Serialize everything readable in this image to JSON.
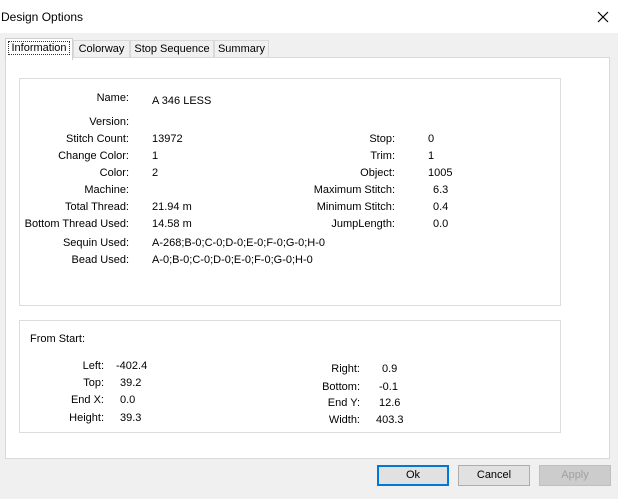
{
  "window": {
    "title": "Design Options",
    "close_icon": "close-icon"
  },
  "tabs": [
    "Information",
    "Colorway",
    "Stop Sequence",
    "Summary"
  ],
  "info": {
    "name_label": "Name:",
    "name_value": "A 346 LESS",
    "version_label": "Version:",
    "version_value": "",
    "stitch_count_label": "Stitch Count:",
    "stitch_count_value": "13972",
    "change_color_label": "Change Color:",
    "change_color_value": "1",
    "color_label": "Color:",
    "color_value": "2",
    "machine_label": "Machine:",
    "machine_value": "",
    "total_thread_label": "Total Thread:",
    "total_thread_value": "21.94 m",
    "bottom_thread_label": "Bottom Thread Used:",
    "bottom_thread_value": "14.58 m",
    "sequin_label": "Sequin Used:",
    "sequin_value": "A-268;B-0;C-0;D-0;E-0;F-0;G-0;H-0",
    "bead_label": "Bead Used:",
    "bead_value": "A-0;B-0;C-0;D-0;E-0;F-0;G-0;H-0",
    "stop_label": "Stop:",
    "stop_value": "0",
    "trim_label": "Trim:",
    "trim_value": "1",
    "object_label": "Object:",
    "object_value": "1005",
    "max_stitch_label": "Maximum Stitch:",
    "max_stitch_value": "6.3",
    "min_stitch_label": "Minimum Stitch:",
    "min_stitch_value": "0.4",
    "jump_length_label": "JumpLength:",
    "jump_length_value": "0.0"
  },
  "from_start": {
    "heading": "From Start:",
    "left_label": "Left:",
    "left_value": "-402.4",
    "top_label": "Top:",
    "top_value": "39.2",
    "end_x_label": "End X:",
    "end_x_value": "0.0",
    "height_label": "Height:",
    "height_value": "39.3",
    "right_label": "Right:",
    "right_value": "0.9",
    "bottom_label": "Bottom:",
    "bottom_value": "-0.1",
    "end_y_label": "End Y:",
    "end_y_value": "12.6",
    "width_label": "Width:",
    "width_value": "403.3"
  },
  "buttons": {
    "ok": "Ok",
    "cancel": "Cancel",
    "apply": "Apply"
  },
  "colors": {
    "accent": "#0078d7",
    "dialog_bg": "#f0f0f0"
  }
}
